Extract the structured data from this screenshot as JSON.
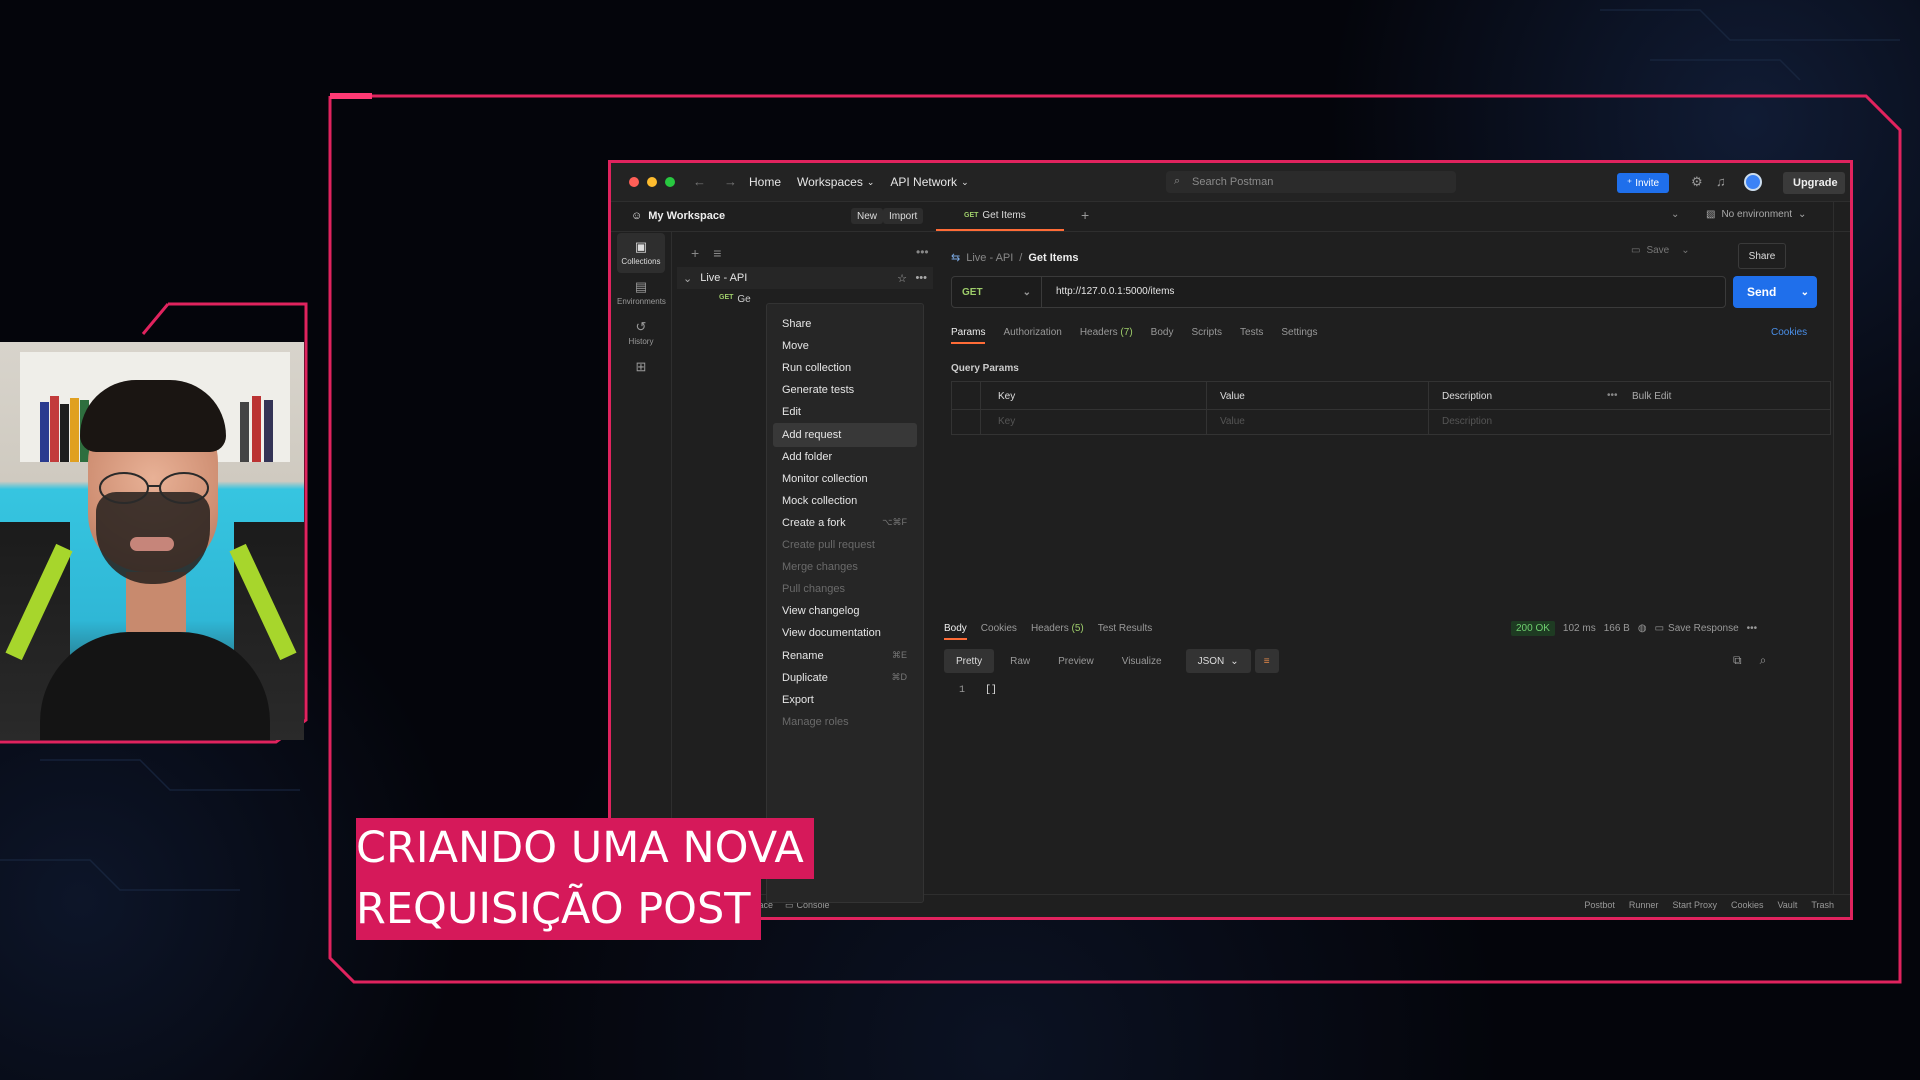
{
  "postman": {
    "nav": {
      "home": "Home",
      "workspaces": "Workspaces",
      "api_network": "API Network",
      "search_placeholder": "Search Postman",
      "invite": "Invite",
      "upgrade": "Upgrade"
    },
    "workspace": {
      "name": "My Workspace",
      "new": "New",
      "import": "Import"
    },
    "rail": [
      {
        "label": "Collections",
        "icon": "collections-icon"
      },
      {
        "label": "Environments",
        "icon": "environments-icon"
      },
      {
        "label": "History",
        "icon": "history-icon"
      }
    ],
    "collection": {
      "name": "Live - API",
      "request_method": "GET",
      "request_name": "Ge"
    },
    "context_menu": [
      {
        "label": "Share",
        "shortcut": "",
        "disabled": false
      },
      {
        "label": "Move",
        "shortcut": "",
        "disabled": false
      },
      {
        "label": "Run collection",
        "shortcut": "",
        "disabled": false
      },
      {
        "label": "Generate tests",
        "shortcut": "",
        "disabled": false
      },
      {
        "label": "Edit",
        "shortcut": "",
        "disabled": false
      },
      {
        "label": "Add request",
        "shortcut": "",
        "disabled": false,
        "highlighted": true
      },
      {
        "label": "Add folder",
        "shortcut": "",
        "disabled": false
      },
      {
        "label": "Monitor collection",
        "shortcut": "",
        "disabled": false
      },
      {
        "label": "Mock collection",
        "shortcut": "",
        "disabled": false
      },
      {
        "label": "Create a fork",
        "shortcut": "⌥⌘F",
        "disabled": false
      },
      {
        "label": "Create pull request",
        "shortcut": "",
        "disabled": true
      },
      {
        "label": "Merge changes",
        "shortcut": "",
        "disabled": true
      },
      {
        "label": "Pull changes",
        "shortcut": "",
        "disabled": true
      },
      {
        "label": "View changelog",
        "shortcut": "",
        "disabled": false
      },
      {
        "label": "View documentation",
        "shortcut": "",
        "disabled": false
      },
      {
        "label": "Rename",
        "shortcut": "⌘E",
        "disabled": false
      },
      {
        "label": "Duplicate",
        "shortcut": "⌘D",
        "disabled": false
      },
      {
        "label": "Export",
        "shortcut": "",
        "disabled": false
      },
      {
        "label": "Manage roles",
        "shortcut": "",
        "disabled": true
      }
    ],
    "tab": {
      "method": "GET",
      "name": "Get Items"
    },
    "environment": "No environment",
    "breadcrumb": {
      "parent": "Live - API",
      "separator": "/",
      "current": "Get Items"
    },
    "save": "Save",
    "share": "Share",
    "request": {
      "method": "GET",
      "url": "http://127.0.0.1:5000/items",
      "send": "Send"
    },
    "request_tabs": {
      "params": "Params",
      "authorization": "Authorization",
      "headers": "Headers",
      "headers_count": "(7)",
      "body": "Body",
      "scripts": "Scripts",
      "tests": "Tests",
      "settings": "Settings",
      "cookies": "Cookies"
    },
    "query_params": {
      "title": "Query Params",
      "headers": [
        "Key",
        "Value",
        "Description"
      ],
      "bulk_edit": "Bulk Edit",
      "placeholders": [
        "Key",
        "Value",
        "Description"
      ]
    },
    "response": {
      "tabs": {
        "body": "Body",
        "cookies": "Cookies",
        "headers": "Headers",
        "headers_count": "(5)",
        "test_results": "Test Results"
      },
      "status": "200 OK",
      "time": "102 ms",
      "size": "166 B",
      "save_response": "Save Response",
      "formats": [
        "Pretty",
        "Raw",
        "Preview",
        "Visualize"
      ],
      "format_select": "JSON",
      "line_number": "1",
      "body": "[]"
    },
    "footer": {
      "left_fragment": "nd replace",
      "console": "Console",
      "items": [
        "Postbot",
        "Runner",
        "Start Proxy",
        "Cookies",
        "Vault",
        "Trash"
      ]
    }
  },
  "caption": {
    "line1": "CRIANDO UMA NOVA",
    "line2": "REQUISIÇÃO POST"
  },
  "colors": {
    "accent_frame": "#e0235e",
    "caption_bg": "#d6195a",
    "send_blue": "#1f6feb",
    "get_green": "#9ecd6a"
  }
}
